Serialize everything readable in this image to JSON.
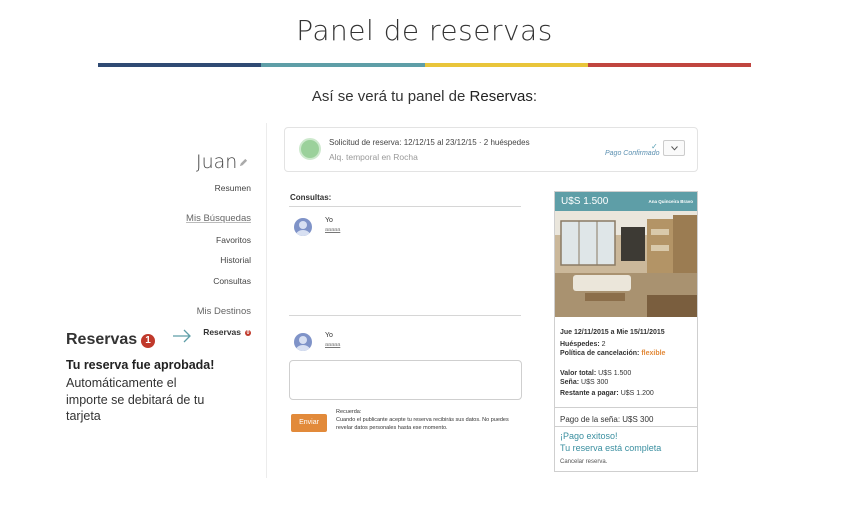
{
  "header": {
    "title": "Panel de reservas",
    "subtitle_prefix": "Así se verá tu panel de ",
    "subtitle_emph": "Reservas",
    "subtitle_suffix": ":",
    "bar_colors": [
      "#2f4a73",
      "#5e9ea7",
      "#e9c53a",
      "#c0453f"
    ]
  },
  "sidebar": {
    "user_name": "Juan",
    "items": [
      {
        "label": "Resumen"
      },
      {
        "label": "Mis Búsquedas"
      },
      {
        "label": "Favoritos"
      },
      {
        "label": "Historial"
      },
      {
        "label": "Consultas"
      },
      {
        "label": "Mis Destinos"
      },
      {
        "label": "Reservas",
        "badge": "0"
      }
    ]
  },
  "callout": {
    "title": "Reservas",
    "badge": "1",
    "bold_line": "Tu reserva fue aprobada!",
    "text": "Automáticamente el importe se debitará de tu tarjeta"
  },
  "booking_card": {
    "request": "Solicitud de reserva:  12/12/15 al 23/12/15  ·  2 huéspedes",
    "listing": "Alq. temporal en Rocha",
    "check": "✓",
    "status": "Pago Confirmado"
  },
  "consultas": {
    "title": "Consultas:",
    "messages": [
      {
        "name": "Yo",
        "sub": "aaaaa"
      },
      {
        "name": "Yo",
        "sub": "aaaaa"
      }
    ],
    "send_label": "Enviar",
    "reminder_title": "Recuerda:",
    "reminder_text": "Cuando el publicante acepte tu reserva recibirás sus datos. No puedes revelar datos personales hasta ese momento."
  },
  "property_card": {
    "price": "U$S 1.500",
    "location": "Ana Quinceira Bravo",
    "dates": "Jue 12/11/2015 a Mie 15/11/2015",
    "guests_label": "Huéspedes:",
    "guests_value": "2",
    "cancel_policy_label": "Política de cancelación:",
    "cancel_policy_value": "flexible",
    "total_label": "Valor total:",
    "total_value": "U$S 1.500",
    "deposit_label": "Seña:",
    "deposit_value": "U$S 300",
    "remaining_label": "Restante a pagar:",
    "remaining_value": "U$S 1.200",
    "deposit_payment": "Pago de la seña: U$S 300",
    "success_line1": "¡Pago exitoso!",
    "success_line2": "Tu reserva está completa",
    "cancel_link": "Cancelar reserva."
  }
}
